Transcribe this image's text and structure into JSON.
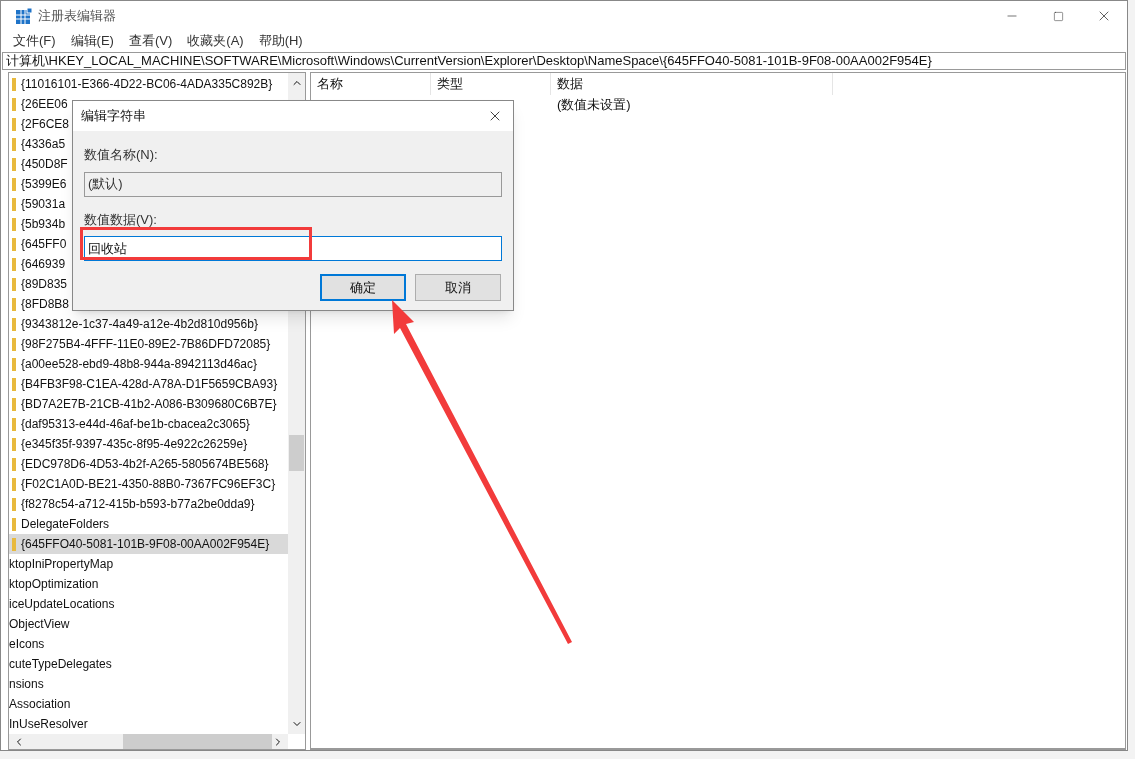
{
  "window": {
    "title": "注册表编辑器"
  },
  "menu": [
    "文件(F)",
    "编辑(E)",
    "查看(V)",
    "收藏夹(A)",
    "帮助(H)"
  ],
  "address": "计算机\\HKEY_LOCAL_MACHINE\\SOFTWARE\\Microsoft\\Windows\\CurrentVersion\\Explorer\\Desktop\\NameSpace\\{645FFO40-5081-101B-9F08-00AA002F954E}",
  "tree": [
    {
      "label": "{11016101-E366-4D22-BC06-4ADA335C892B}",
      "kind": "folder",
      "selected": false
    },
    {
      "label": "{26EE06",
      "kind": "folder",
      "selected": false
    },
    {
      "label": "{2F6CE8",
      "kind": "folder",
      "selected": false
    },
    {
      "label": "{4336a5",
      "kind": "folder",
      "selected": false
    },
    {
      "label": "{450D8F",
      "kind": "folder",
      "selected": false
    },
    {
      "label": "{5399E6",
      "kind": "folder",
      "selected": false
    },
    {
      "label": "{59031a",
      "kind": "folder",
      "selected": false
    },
    {
      "label": "{5b934b",
      "kind": "folder",
      "selected": false
    },
    {
      "label": "{645FF0",
      "kind": "folder",
      "selected": false
    },
    {
      "label": "{646939",
      "kind": "folder",
      "selected": false
    },
    {
      "label": "{89D835",
      "kind": "folder",
      "selected": false
    },
    {
      "label": "{8FD8B8",
      "kind": "folder",
      "selected": false
    },
    {
      "label": "{9343812e-1c37-4a49-a12e-4b2d810d956b}",
      "kind": "folder",
      "selected": false
    },
    {
      "label": "{98F275B4-4FFF-11E0-89E2-7B86DFD72085}",
      "kind": "folder",
      "selected": false
    },
    {
      "label": "{a00ee528-ebd9-48b8-944a-8942113d46ac}",
      "kind": "folder",
      "selected": false
    },
    {
      "label": "{B4FB3F98-C1EA-428d-A78A-D1F5659CBA93}",
      "kind": "folder",
      "selected": false
    },
    {
      "label": "{BD7A2E7B-21CB-41b2-A086-B309680C6B7E}",
      "kind": "folder",
      "selected": false
    },
    {
      "label": "{daf95313-e44d-46af-be1b-cbacea2c3065}",
      "kind": "folder",
      "selected": false
    },
    {
      "label": "{e345f35f-9397-435c-8f95-4e922c26259e}",
      "kind": "folder",
      "selected": false
    },
    {
      "label": "{EDC978D6-4D53-4b2f-A265-5805674BE568}",
      "kind": "folder",
      "selected": false
    },
    {
      "label": "{F02C1A0D-BE21-4350-88B0-7367FC96EF3C}",
      "kind": "folder",
      "selected": false
    },
    {
      "label": "{f8278c54-a712-415b-b593-b77a2be0dda9}",
      "kind": "folder",
      "selected": false
    },
    {
      "label": "DelegateFolders",
      "kind": "folder",
      "selected": false
    },
    {
      "label": "{645FFO40-5081-101B-9F08-00AA002F954E}",
      "kind": "folder",
      "selected": true
    },
    {
      "label": "ktopIniPropertyMap",
      "kind": "plain",
      "selected": false
    },
    {
      "label": "ktopOptimization",
      "kind": "plain",
      "selected": false
    },
    {
      "label": "iceUpdateLocations",
      "kind": "plain",
      "selected": false
    },
    {
      "label": "ObjectView",
      "kind": "plain",
      "selected": false
    },
    {
      "label": "eIcons",
      "kind": "plain",
      "selected": false
    },
    {
      "label": "cuteTypeDelegates",
      "kind": "plain",
      "selected": false
    },
    {
      "label": "nsions",
      "kind": "plain",
      "selected": false
    },
    {
      "label": "Association",
      "kind": "plain",
      "selected": false
    },
    {
      "label": "InUseResolver",
      "kind": "plain",
      "selected": false
    }
  ],
  "columns": [
    "名称",
    "类型",
    "数据"
  ],
  "rows": [
    {
      "data": "(数值未设置)"
    }
  ],
  "dialog": {
    "title": "编辑字符串",
    "name_label": "数值名称(N):",
    "name_value": "(默认)",
    "data_label": "数值数据(V):",
    "data_value": "回收站",
    "buttons": [
      {
        "label": "确定",
        "focused": true
      },
      {
        "label": "取消",
        "focused": false
      }
    ]
  }
}
